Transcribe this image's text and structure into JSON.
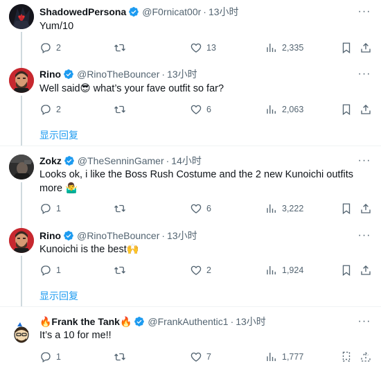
{
  "posts": [
    {
      "name": "ShadowedPersona",
      "name_prefix": "",
      "name_suffix": "",
      "handle": "@F0rnicat00r",
      "time": "13小时",
      "text": "Yum/10",
      "replies": "2",
      "likes": "13",
      "views": "2,335"
    },
    {
      "name": "Rino",
      "handle": "@RinoTheBouncer",
      "time": "13小时",
      "text": "Well said😎 what’s your fave outfit so far?",
      "replies": "2",
      "likes": "6",
      "views": "2,063"
    },
    {
      "name": "Zokz",
      "handle": "@TheSenninGamer",
      "time": "14小时",
      "text": "Looks ok, i like the Boss Rush Costume and the 2 new Kunoichi outfits more 🤷‍♂️",
      "replies": "1",
      "likes": "6",
      "views": "3,222"
    },
    {
      "name": "Rino",
      "handle": "@RinoTheBouncer",
      "time": "13小时",
      "text": "Kunoichi is the best🙌",
      "replies": "1",
      "likes": "2",
      "views": "1,924"
    },
    {
      "name": "🔥Frank the Tank🔥",
      "handle": "@FrankAuthentic1",
      "time": "13小时",
      "text": "It’s a 10 for me!!",
      "replies": "1",
      "likes": "7",
      "views": "1,777"
    }
  ],
  "show_replies_label": "显示回复",
  "more_glyph": "···",
  "dot": "·",
  "colors": {
    "accent": "#1d9bf0",
    "muted": "#536471",
    "verified": "#1d9bf0",
    "divider": "#eff3f4"
  }
}
